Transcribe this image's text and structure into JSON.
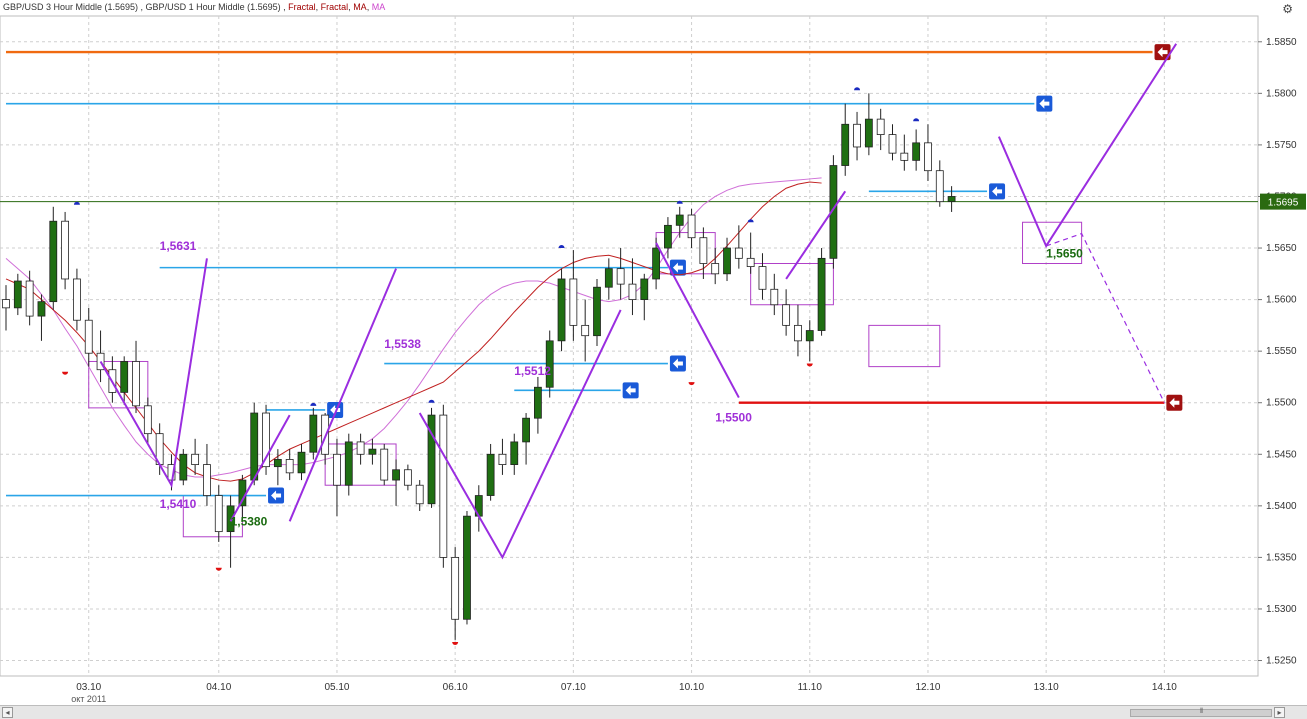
{
  "header": {
    "title_main": "GBP/USD 3 Hour Middle (1.5695) , GBP/USD 1 Hour Middle (1.5695) , ",
    "title_fractal1": "Fractal",
    "title_sep1": ", ",
    "title_fractal2": "Fractal",
    "title_sep2": ", ",
    "title_ma1": "MA",
    "title_sep3": ", ",
    "title_ma2": "MA"
  },
  "colors": {
    "bull": "#1f6f12",
    "bear": "#ffffff",
    "wick": "#222222",
    "ma_red": "#c02020",
    "ma_violet": "#d070d8",
    "trend": "#9a2de0",
    "level_blue": "#2aa5e8",
    "level_orange": "#f06a10",
    "level_red": "#e01010",
    "current_line": "#2a6a10",
    "label_purple": "#a030d8",
    "fractal_up": "#1a2ac0",
    "fractal_down": "#e01010",
    "grid": "#cfcfcf"
  },
  "chart_data": {
    "type": "candlestick",
    "symbol": "GBP/USD",
    "timeframe": "1 Hour",
    "last_price": "1.5695",
    "ylim": [
      1.5235,
      1.5875
    ],
    "y_ticks": [
      "1.5850",
      "1.5800",
      "1.5750",
      "1.5700",
      "1.5650",
      "1.5600",
      "1.5550",
      "1.5500",
      "1.5450",
      "1.5400",
      "1.5350",
      "1.5300",
      "1.5250"
    ],
    "x_ticks": [
      {
        "label": "03.10",
        "index": 7
      },
      {
        "label": "04.10",
        "index": 18
      },
      {
        "label": "05.10",
        "index": 28
      },
      {
        "label": "06.10",
        "index": 38
      },
      {
        "label": "07.10",
        "index": 48
      },
      {
        "label": "10.10",
        "index": 58
      },
      {
        "label": "11.10",
        "index": 68
      },
      {
        "label": "12.10",
        "index": 78
      },
      {
        "label": "13.10",
        "index": 88
      },
      {
        "label": "14.10",
        "index": 98
      }
    ],
    "month_label": "окт 2011",
    "hline_levels": [
      {
        "price": 1.584,
        "color_key": "level_orange",
        "from": 0,
        "to": 97,
        "arrow": "red"
      },
      {
        "price": 1.579,
        "color_key": "level_blue",
        "from": 0,
        "to": 87,
        "arrow": "blue"
      },
      {
        "price": 1.5631,
        "color_key": "level_blue",
        "from": 13,
        "to": 56,
        "arrow": "blue"
      },
      {
        "price": 1.5538,
        "color_key": "level_blue",
        "from": 32,
        "to": 56,
        "arrow": "blue"
      },
      {
        "price": 1.5512,
        "color_key": "level_blue",
        "from": 43,
        "to": 52,
        "arrow": "blue"
      },
      {
        "price": 1.5493,
        "color_key": "level_blue",
        "from": 22,
        "to": 27,
        "arrow": "blue"
      },
      {
        "price": 1.541,
        "color_key": "level_blue",
        "from": 0,
        "to": 22,
        "arrow": "blue"
      },
      {
        "price": 1.5705,
        "color_key": "level_blue",
        "from": 73,
        "to": 83,
        "arrow": "blue"
      },
      {
        "price": 1.55,
        "color_key": "level_red",
        "from": 62,
        "to": 98,
        "arrow": "red"
      }
    ],
    "level_labels": [
      {
        "text": "1,5631",
        "index": 13,
        "price": 1.5648
      },
      {
        "text": "1,5538",
        "index": 32,
        "price": 1.5553
      },
      {
        "text": "1,5512",
        "index": 43,
        "price": 1.5527
      },
      {
        "text": "1,5410",
        "index": 13,
        "price": 1.5398
      },
      {
        "text": "1,5380",
        "index": 19,
        "price": 1.5381
      },
      {
        "text": "1,5500",
        "index": 60,
        "price": 1.5482
      },
      {
        "text": "1,5650",
        "index": 88,
        "price": 1.5641
      }
    ],
    "candles": [
      [
        1.56,
        1.5614,
        1.557,
        1.5592
      ],
      [
        1.5592,
        1.5625,
        1.5585,
        1.5618
      ],
      [
        1.5618,
        1.5628,
        1.5575,
        1.5584
      ],
      [
        1.5584,
        1.5605,
        1.556,
        1.5598
      ],
      [
        1.5598,
        1.569,
        1.559,
        1.5676
      ],
      [
        1.5676,
        1.5685,
        1.561,
        1.562
      ],
      [
        1.562,
        1.563,
        1.557,
        1.558
      ],
      [
        1.558,
        1.5592,
        1.5535,
        1.5548
      ],
      [
        1.5548,
        1.557,
        1.552,
        1.5532
      ],
      [
        1.5532,
        1.5545,
        1.55,
        1.551
      ],
      [
        1.551,
        1.5545,
        1.5498,
        1.554
      ],
      [
        1.554,
        1.556,
        1.549,
        1.5497
      ],
      [
        1.5497,
        1.5505,
        1.546,
        1.547
      ],
      [
        1.547,
        1.548,
        1.543,
        1.544
      ],
      [
        1.544,
        1.545,
        1.5415,
        1.5425
      ],
      [
        1.5425,
        1.5455,
        1.542,
        1.545
      ],
      [
        1.545,
        1.5465,
        1.543,
        1.544
      ],
      [
        1.544,
        1.546,
        1.54,
        1.541
      ],
      [
        1.541,
        1.542,
        1.5365,
        1.5375
      ],
      [
        1.5375,
        1.541,
        1.534,
        1.54
      ],
      [
        1.54,
        1.543,
        1.5385,
        1.5425
      ],
      [
        1.5425,
        1.55,
        1.542,
        1.549
      ],
      [
        1.549,
        1.5498,
        1.543,
        1.5438
      ],
      [
        1.5438,
        1.5455,
        1.542,
        1.5445
      ],
      [
        1.5445,
        1.5455,
        1.5425,
        1.5432
      ],
      [
        1.5432,
        1.546,
        1.5425,
        1.5452
      ],
      [
        1.5452,
        1.5495,
        1.5445,
        1.5488
      ],
      [
        1.5488,
        1.549,
        1.544,
        1.545
      ],
      [
        1.545,
        1.5465,
        1.539,
        1.542
      ],
      [
        1.542,
        1.547,
        1.541,
        1.5462
      ],
      [
        1.5462,
        1.547,
        1.544,
        1.545
      ],
      [
        1.545,
        1.5465,
        1.544,
        1.5455
      ],
      [
        1.5455,
        1.546,
        1.542,
        1.5425
      ],
      [
        1.5425,
        1.5445,
        1.54,
        1.5435
      ],
      [
        1.5435,
        1.544,
        1.5415,
        1.542
      ],
      [
        1.542,
        1.5425,
        1.5395,
        1.5402
      ],
      [
        1.5402,
        1.5495,
        1.5398,
        1.5488
      ],
      [
        1.5488,
        1.5498,
        1.534,
        1.535
      ],
      [
        1.535,
        1.536,
        1.527,
        1.529
      ],
      [
        1.529,
        1.5395,
        1.5285,
        1.539
      ],
      [
        1.539,
        1.542,
        1.5375,
        1.541
      ],
      [
        1.541,
        1.546,
        1.5405,
        1.545
      ],
      [
        1.545,
        1.5465,
        1.543,
        1.544
      ],
      [
        1.544,
        1.547,
        1.543,
        1.5462
      ],
      [
        1.5462,
        1.549,
        1.544,
        1.5485
      ],
      [
        1.5485,
        1.5525,
        1.547,
        1.5515
      ],
      [
        1.5515,
        1.557,
        1.5505,
        1.556
      ],
      [
        1.556,
        1.563,
        1.555,
        1.562
      ],
      [
        1.562,
        1.5648,
        1.556,
        1.5575
      ],
      [
        1.5575,
        1.56,
        1.554,
        1.5565
      ],
      [
        1.5565,
        1.562,
        1.5555,
        1.5612
      ],
      [
        1.5612,
        1.564,
        1.56,
        1.563
      ],
      [
        1.563,
        1.565,
        1.56,
        1.5615
      ],
      [
        1.5615,
        1.564,
        1.5585,
        1.56
      ],
      [
        1.56,
        1.5625,
        1.558,
        1.562
      ],
      [
        1.562,
        1.566,
        1.561,
        1.565
      ],
      [
        1.565,
        1.568,
        1.564,
        1.5672
      ],
      [
        1.5672,
        1.569,
        1.566,
        1.5682
      ],
      [
        1.5682,
        1.5688,
        1.565,
        1.566
      ],
      [
        1.566,
        1.567,
        1.562,
        1.5635
      ],
      [
        1.5635,
        1.565,
        1.5615,
        1.5625
      ],
      [
        1.5625,
        1.566,
        1.5618,
        1.565
      ],
      [
        1.565,
        1.5672,
        1.563,
        1.564
      ],
      [
        1.564,
        1.5665,
        1.5625,
        1.5632
      ],
      [
        1.5632,
        1.5645,
        1.56,
        1.561
      ],
      [
        1.561,
        1.5625,
        1.5585,
        1.5595
      ],
      [
        1.5595,
        1.561,
        1.5565,
        1.5575
      ],
      [
        1.5575,
        1.5595,
        1.5545,
        1.556
      ],
      [
        1.556,
        1.558,
        1.554,
        1.557
      ],
      [
        1.557,
        1.565,
        1.5565,
        1.564
      ],
      [
        1.564,
        1.574,
        1.563,
        1.573
      ],
      [
        1.573,
        1.579,
        1.572,
        1.577
      ],
      [
        1.577,
        1.5782,
        1.5735,
        1.5748
      ],
      [
        1.5748,
        1.58,
        1.574,
        1.5775
      ],
      [
        1.5775,
        1.5785,
        1.5745,
        1.576
      ],
      [
        1.576,
        1.577,
        1.5735,
        1.5742
      ],
      [
        1.5742,
        1.576,
        1.5725,
        1.5735
      ],
      [
        1.5735,
        1.5765,
        1.5725,
        1.5752
      ],
      [
        1.5752,
        1.577,
        1.5715,
        1.5725
      ],
      [
        1.5725,
        1.5735,
        1.569,
        1.5695
      ],
      [
        1.5695,
        1.571,
        1.5685,
        1.57
      ]
    ],
    "ma_red": [
      1.562,
      1.5615,
      1.561,
      1.56,
      1.559,
      1.558,
      1.5568,
      1.5555,
      1.554,
      1.5525,
      1.551,
      1.5495,
      1.548,
      1.5465,
      1.5452,
      1.544,
      1.5432,
      1.5428,
      1.5425,
      1.5424,
      1.5426,
      1.5432,
      1.544,
      1.5448,
      1.5455,
      1.546,
      1.5465,
      1.547,
      1.5475,
      1.548,
      1.5485,
      1.549,
      1.5495,
      1.55,
      1.5505,
      1.551,
      1.5515,
      1.552,
      1.553,
      1.554,
      1.555,
      1.5562,
      1.5575,
      1.5588,
      1.56,
      1.5612,
      1.5622,
      1.563,
      1.5636,
      1.564,
      1.5642,
      1.5643,
      1.564,
      1.5636,
      1.5632,
      1.5628,
      1.5625,
      1.5624,
      1.5626,
      1.563,
      1.564,
      1.5652,
      1.5665,
      1.5678,
      1.569,
      1.57,
      1.5708,
      1.5712,
      1.5714,
      1.5713
    ],
    "ma_violet": [
      1.564,
      1.563,
      1.562,
      1.5605,
      1.559,
      1.5572,
      1.5555,
      1.5535,
      1.5515,
      1.5495,
      1.5478,
      1.5462,
      1.545,
      1.544,
      1.5435,
      1.543,
      1.5428,
      1.5428,
      1.543,
      1.5432,
      1.5435,
      1.5438,
      1.544,
      1.544,
      1.544,
      1.544,
      1.5442,
      1.5445,
      1.5448,
      1.5452,
      1.5458,
      1.5465,
      1.5475,
      1.5488,
      1.5502,
      1.5518,
      1.5535,
      1.5552,
      1.5568,
      1.5582,
      1.5595,
      1.5605,
      1.5612,
      1.5616,
      1.5618,
      1.5618,
      1.5616,
      1.5612,
      1.5608,
      1.5604,
      1.56,
      1.5598,
      1.56,
      1.5605,
      1.5615,
      1.563,
      1.5648,
      1.5665,
      1.568,
      1.5692,
      1.57,
      1.5706,
      1.571,
      1.5712,
      1.5713,
      1.5714,
      1.5715,
      1.5716,
      1.5717,
      1.5718
    ],
    "fractals_up": [
      {
        "index": 6,
        "price": 1.5692
      },
      {
        "index": 26,
        "price": 1.5497
      },
      {
        "index": 36,
        "price": 1.55
      },
      {
        "index": 47,
        "price": 1.565
      },
      {
        "index": 57,
        "price": 1.5693
      },
      {
        "index": 63,
        "price": 1.5675
      },
      {
        "index": 72,
        "price": 1.5803
      },
      {
        "index": 77,
        "price": 1.5773
      }
    ],
    "fractals_down": [
      {
        "index": 5,
        "price": 1.553
      },
      {
        "index": 18,
        "price": 1.534
      },
      {
        "index": 38,
        "price": 1.5268
      },
      {
        "index": 58,
        "price": 1.552
      },
      {
        "index": 68,
        "price": 1.5538
      }
    ],
    "trend_lines": [
      [
        [
          8,
          1.554
        ],
        [
          14,
          1.542
        ],
        [
          17,
          1.564
        ]
      ],
      [
        [
          19,
          1.5385
        ],
        [
          24,
          1.5488
        ]
      ],
      [
        [
          24,
          1.5385
        ],
        [
          33,
          1.563
        ]
      ],
      [
        [
          35,
          1.549
        ],
        [
          42,
          1.535
        ],
        [
          52,
          1.559
        ]
      ],
      [
        [
          55,
          1.5655
        ],
        [
          62,
          1.5505
        ]
      ],
      [
        [
          66,
          1.562
        ],
        [
          71,
          1.5705
        ]
      ],
      [
        [
          84,
          1.5758
        ],
        [
          88,
          1.5652
        ],
        [
          99,
          1.5848
        ]
      ]
    ],
    "projection_lines": [
      [
        [
          88,
          1.5652
        ],
        [
          91,
          1.5664
        ],
        [
          98,
          1.55
        ]
      ]
    ],
    "boxes": [
      {
        "i0": 7,
        "i1": 12,
        "p0": 1.5495,
        "p1": 1.554
      },
      {
        "i0": 15,
        "i1": 20,
        "p0": 1.537,
        "p1": 1.541
      },
      {
        "i0": 27,
        "i1": 33,
        "p0": 1.542,
        "p1": 1.546
      },
      {
        "i0": 55,
        "i1": 60,
        "p0": 1.5625,
        "p1": 1.5665
      },
      {
        "i0": 63,
        "i1": 70,
        "p0": 1.5595,
        "p1": 1.5635
      },
      {
        "i0": 73,
        "i1": 79,
        "p0": 1.5535,
        "p1": 1.5575
      },
      {
        "i0": 86,
        "i1": 91,
        "p0": 1.5635,
        "p1": 1.5675
      }
    ],
    "current_price_line": 1.5695,
    "current_price_label": "1.5695"
  }
}
